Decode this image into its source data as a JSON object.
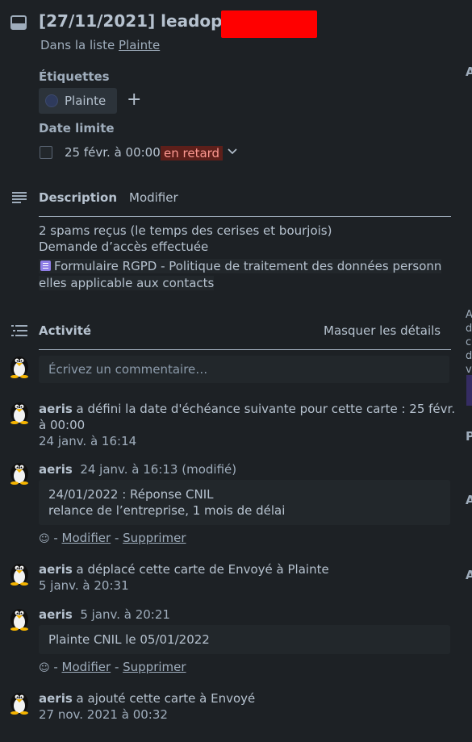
{
  "card": {
    "title": "[27/11/2021] leadoptin",
    "in_list_prefix": "Dans la liste",
    "list_name": "Plainte"
  },
  "labels": {
    "heading": "Étiquettes",
    "items": [
      {
        "name": "Plainte",
        "color": "#2e3a5c"
      }
    ],
    "add_symbol": "+"
  },
  "due": {
    "heading": "Date limite",
    "value": "25 févr. à 00:00",
    "status": "en retard",
    "status_color": "#5d1f1a"
  },
  "description": {
    "heading": "Description",
    "edit_label": "Modifier",
    "lines": [
      "2 spams reçus (le temps des cerises et bourjois)",
      "Demande d’accès effectuée"
    ],
    "attachment_line1": "Formulaire RGPD - Politique de traitement des données personn",
    "attachment_line2": "elles applicable aux contacts"
  },
  "activity": {
    "heading": "Activité",
    "toggle_label": "Masquer les détails",
    "comment_placeholder": "Écrivez un commentaire…",
    "entries": [
      {
        "user": "aeris",
        "text": "a défini la date d'échéance suivante pour cette carte : 25 févr.",
        "text2": "à 00:00",
        "time": "24 janv. à 16:14"
      },
      {
        "user": "aeris",
        "time": "24 janv. à 16:13 (modifié)",
        "comment_line1": "24/01/2022 : Réponse CNIL",
        "comment_line2": "relance de l’entreprise, 1 mois de délai",
        "modify": "Modifier",
        "delete": "Supprimer"
      },
      {
        "user": "aeris",
        "text": "a déplacé cette carte de Envoyé à Plainte",
        "time": "5 janv. à 20:31"
      },
      {
        "user": "aeris",
        "time": "5 janv. à 20:21",
        "comment_line1": "Plainte CNIL le 05/01/2022",
        "modify": "Modifier",
        "delete": "Supprimer"
      },
      {
        "user": "aeris",
        "text": "a ajouté cette carte à Envoyé",
        "time": "27 nov. 2021 à 00:32"
      }
    ]
  },
  "sidebar_partial": {
    "letters": [
      "A",
      "A",
      "d",
      "c",
      "d",
      "v",
      "P",
      "A",
      "A"
    ]
  },
  "colors": {
    "background": "#1d2125",
    "text": "#b6c2cf",
    "redaction": "#ff0000",
    "attachment_icon": "#8f7ee7"
  }
}
